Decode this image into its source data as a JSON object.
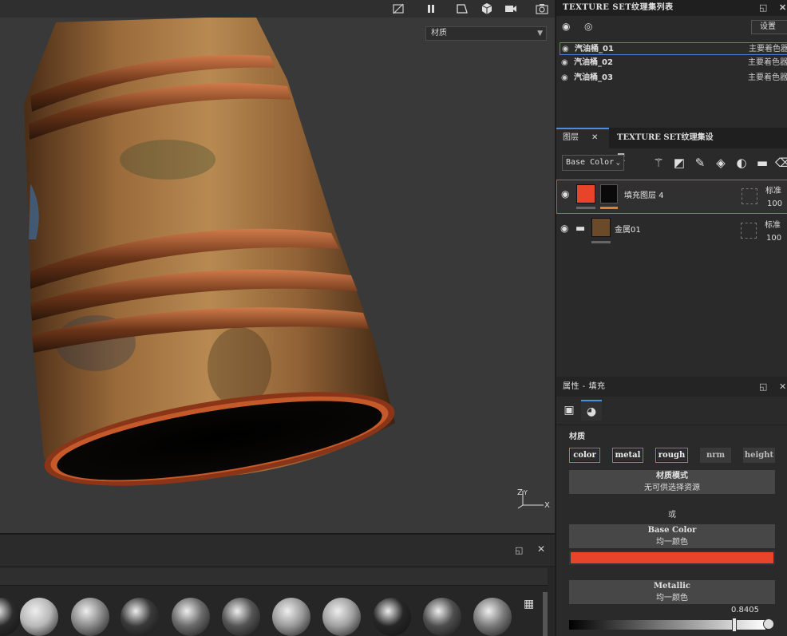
{
  "viewport": {
    "material_select": "材质",
    "axis_labels": {
      "z": "Z",
      "y": "Y",
      "x": "X"
    },
    "toolbar_icons": [
      "hide-icon",
      "pause-icon",
      "camera-view-icon",
      "cube-icon",
      "video-camera-icon",
      "screenshot-icon"
    ]
  },
  "shelf": {
    "icons": [
      "detach-icon",
      "close-icon",
      "grid-view-icon"
    ],
    "materials": [
      {
        "name": "smart-material-1",
        "color": "#2a2a2a"
      },
      {
        "name": "smart-material-2",
        "color": "#b8b8b8"
      },
      {
        "name": "smart-material-3",
        "color": "#8a8a8a"
      },
      {
        "name": "smart-material-4",
        "color": "#3a3a3a"
      },
      {
        "name": "smart-material-5",
        "color": "#6a6a6a"
      },
      {
        "name": "smart-material-6",
        "color": "#545454"
      },
      {
        "name": "smart-material-7",
        "color": "#9a9a9a"
      },
      {
        "name": "smart-material-8",
        "color": "#a0a0a0"
      },
      {
        "name": "smart-material-9",
        "color": "#262626"
      },
      {
        "name": "smart-material-10",
        "color": "#4e4e4e"
      },
      {
        "name": "smart-material-11",
        "color": "#7a7a7a"
      }
    ]
  },
  "texture_set_list": {
    "title": "TEXTURE SET纹理集列表",
    "settings_label": "设置",
    "items": [
      {
        "name": "汽油桶_01",
        "shader": "主要着色器",
        "selected": true
      },
      {
        "name": "汽油桶_02",
        "shader": "主要着色器",
        "selected": false
      },
      {
        "name": "汽油桶_03",
        "shader": "主要着色器",
        "selected": false
      }
    ]
  },
  "layers": {
    "tab_layers": "图层",
    "tab_close": "✕",
    "tab_settings": "TEXTURE SET纹理集设置",
    "channel_select": "Base Color",
    "items": [
      {
        "name": "填充图层 4",
        "blend": "标准",
        "opacity": "100",
        "selected": true,
        "thumb_color": "#e8442a"
      },
      {
        "name": "金属01",
        "blend": "标准",
        "opacity": "100",
        "selected": false,
        "thumb_color": "#6b4a2a"
      }
    ]
  },
  "properties": {
    "title": "属性 - 填充",
    "section_label": "材质",
    "channels": [
      {
        "label": "color",
        "on": true
      },
      {
        "label": "metal",
        "on": true
      },
      {
        "label": "rough",
        "on": true
      },
      {
        "label": "nrm",
        "on": false
      },
      {
        "label": "height",
        "on": false
      }
    ],
    "material_mode": {
      "title": "材质模式",
      "subtitle": "无可供选择资源"
    },
    "or_label": "或",
    "base_color": {
      "title": "Base Color",
      "subtitle": "均一颜色",
      "color": "#e8442a"
    },
    "metallic": {
      "title": "Metallic",
      "subtitle": "均一颜色",
      "value_text": "0.8405",
      "value": 0.8405
    }
  }
}
